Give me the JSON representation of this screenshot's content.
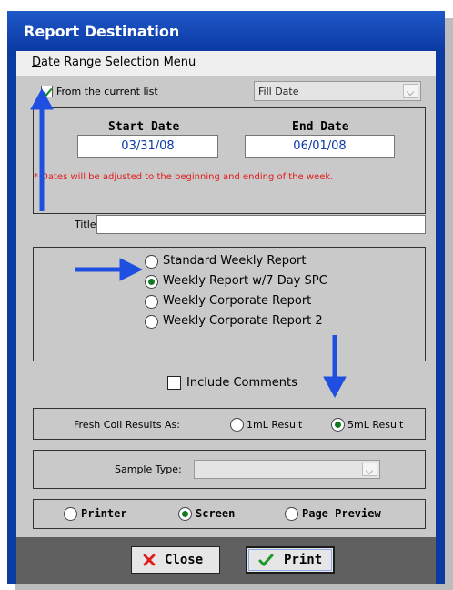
{
  "window": {
    "title": "Report Destination"
  },
  "menu": {
    "first_letter": "D",
    "rest": "ate Range Selection Menu"
  },
  "list": {
    "checkbox_label": "From the current list",
    "checked": true,
    "sort_value": "Fill Date"
  },
  "dates": {
    "start_label": "Start Date",
    "start_value": "03/31/08",
    "end_label": "End Date",
    "end_value": "06/01/08",
    "note": "* Dates will be adjusted to the beginning and ending of the week."
  },
  "title_field": {
    "label": "Title",
    "value": ""
  },
  "report_types": {
    "options": [
      "Standard Weekly Report",
      "Weekly Report w/7 Day SPC",
      "Weekly Corporate Report",
      "Weekly Corporate Report 2"
    ],
    "selected": "Weekly Report w/7 Day SPC"
  },
  "comments": {
    "label": "Include Comments",
    "checked": false
  },
  "coli": {
    "label": "Fresh Coli Results As:",
    "options": [
      "1mL Result",
      "5mL Result"
    ],
    "selected": "5mL Result"
  },
  "sample": {
    "label": "Sample Type:",
    "value": ""
  },
  "output": {
    "options": [
      "Printer",
      "Screen",
      "Page Preview"
    ],
    "selected": "Screen"
  },
  "buttons": {
    "close": "Close",
    "print": "Print"
  },
  "colors": {
    "arrow": "#1f4fe0",
    "window": "#0a3ba0",
    "note": "#e01b1b"
  }
}
